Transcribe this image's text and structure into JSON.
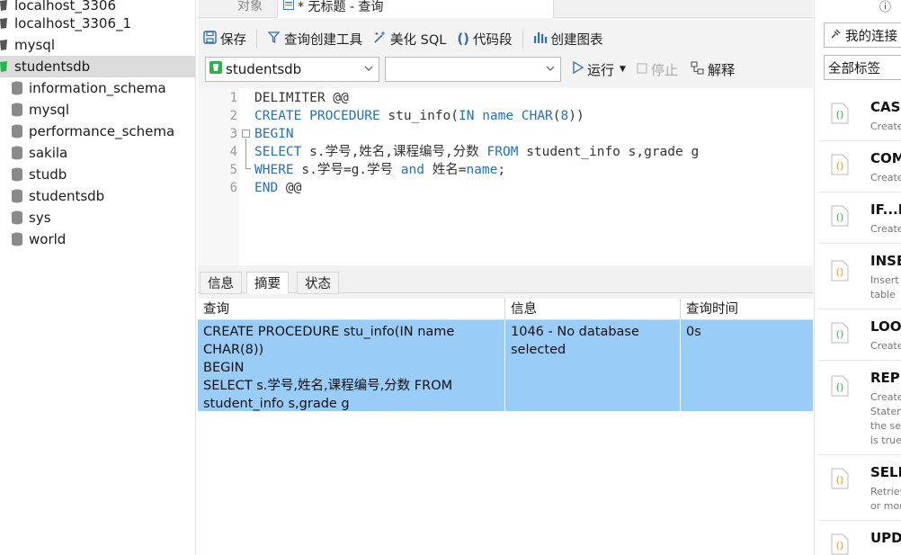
{
  "sidebar": {
    "connections": [
      "localhost_3306",
      "localhost_3306_1",
      "mysql",
      "studentsdb"
    ],
    "databases": [
      "information_schema",
      "mysql",
      "performance_schema",
      "sakila",
      "studb",
      "studentsdb",
      "sys",
      "world"
    ],
    "selected": "studentsdb"
  },
  "tabs": {
    "objects": "对象",
    "query_tab": "* 无标题 - 查询"
  },
  "toolbar": {
    "save": "保存",
    "query_builder": "查询创建工具",
    "beautify": "美化 SQL",
    "snippet": "代码段",
    "chart": "创建图表"
  },
  "selectors": {
    "database": "studentsdb",
    "schema": "",
    "run": "运行",
    "stop": "停止",
    "explain": "解释"
  },
  "editor": {
    "line_numbers": [
      "1",
      "2",
      "3",
      "4",
      "5",
      "6"
    ]
  },
  "result_tabs": [
    "信息",
    "摘要",
    "状态"
  ],
  "result_grid": {
    "headers": [
      "查询",
      "信息",
      "查询时间"
    ],
    "row": {
      "query_lines": [
        "CREATE PROCEDURE stu_info(IN name",
        "CHAR(8))",
        "BEGIN",
        "SELECT s.学号,姓名,课程编号,分数 FROM",
        "student_info s,grade g"
      ],
      "info_lines": [
        "1046 - No database",
        "selected"
      ],
      "time": "0s"
    }
  },
  "right_panel": {
    "info_icon": "ⓘ",
    "my_connections": "我的连接",
    "all_tags": "全部标签",
    "snippets": [
      {
        "title": "CASE",
        "desc": [
          "Create a"
        ]
      },
      {
        "title": "COMM",
        "desc": [
          "Create a"
        ]
      },
      {
        "title": "IF...EL",
        "desc": [
          "Create a"
        ]
      },
      {
        "title": "INSER",
        "desc": [
          "Insert n",
          "table"
        ]
      },
      {
        "title": "LOOP",
        "desc": [
          "Create a"
        ]
      },
      {
        "title": "REPEA",
        "desc": [
          "Create A",
          "Stateme",
          "the sear",
          "is true."
        ]
      },
      {
        "title": "SELEC",
        "desc": [
          "Retrieve",
          "or more"
        ]
      },
      {
        "title": "UPDA",
        "desc": []
      }
    ]
  },
  "colors": {
    "keyword": "#1e6fcf",
    "selected_row": "#99ccf7",
    "connection_green": "#2bb34a"
  }
}
